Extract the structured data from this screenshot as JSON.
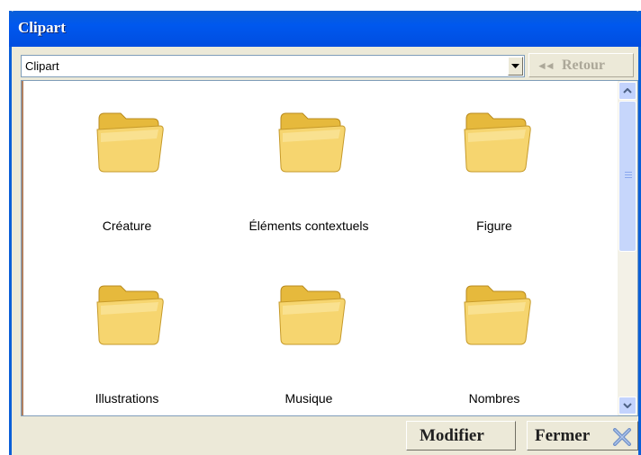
{
  "window": {
    "title": "Clipart"
  },
  "toolbar": {
    "combo_value": "Clipart",
    "back_label": "Retour",
    "back_arrows": "◄◄"
  },
  "folders": [
    {
      "label": "Créature"
    },
    {
      "label": "Éléments contextuels"
    },
    {
      "label": "Figure"
    },
    {
      "label": "Illustrations"
    },
    {
      "label": "Musique"
    },
    {
      "label": "Nombres"
    }
  ],
  "footer": {
    "modify_label": "Modifier",
    "close_label": "Fermer"
  },
  "colors": {
    "titlebar": "#0058ee",
    "window_bg": "#ece9d8",
    "folder": "#f6d56f",
    "disabled_text": "#aca899"
  },
  "icons": {
    "folder": "folder-icon",
    "close": "close-x-icon",
    "back": "double-left-arrow-icon"
  }
}
